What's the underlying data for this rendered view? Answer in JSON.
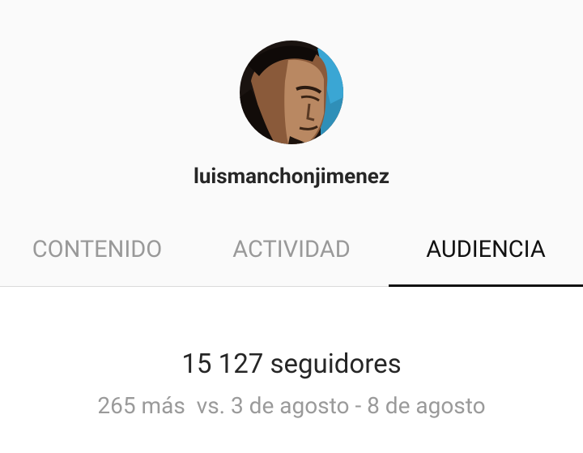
{
  "profile": {
    "username": "luismanchonjimenez",
    "avatar_icon": "user-avatar-photo"
  },
  "tabs": [
    {
      "label": "CONTENIDO",
      "active": false
    },
    {
      "label": "ACTIVIDAD",
      "active": false
    },
    {
      "label": "AUDIENCIA",
      "active": true
    }
  ],
  "audience": {
    "followers_text": "15 127 seguidores",
    "comparison_text": "265 más  vs. 3 de agosto - 8 de agosto"
  },
  "colors": {
    "header_background": "#fafafa",
    "active_tab": "#111111",
    "inactive_tab": "#999999",
    "secondary_text": "#9a9a9a"
  }
}
